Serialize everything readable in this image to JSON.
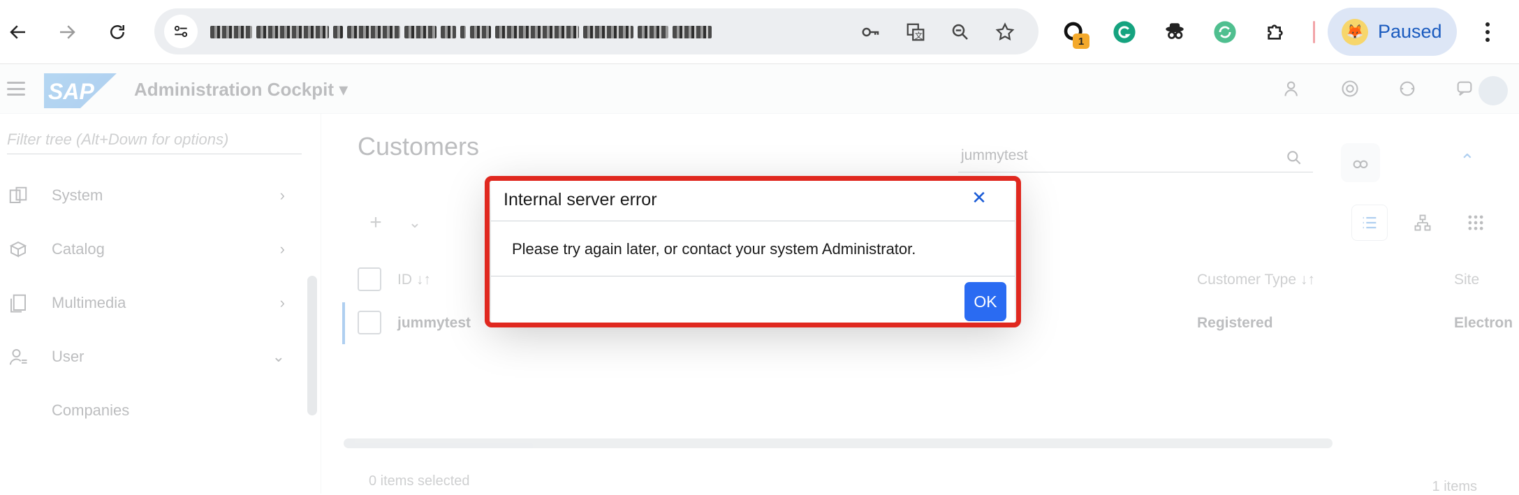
{
  "browser": {
    "url_display": "",
    "extension_badge": "1",
    "profile_label": "Paused",
    "colors": {
      "separator": "#f2a4a8",
      "profile_bg": "#dde6f6",
      "profile_text": "#1a5bbf"
    }
  },
  "app": {
    "title": "Administration Cockpit",
    "brand": "SAP",
    "sidebar": {
      "filter_placeholder": "Filter tree (Alt+Down for options)",
      "items": [
        {
          "label": "System",
          "icon": "system-icon",
          "chevron": "›"
        },
        {
          "label": "Catalog",
          "icon": "catalog-icon",
          "chevron": "›"
        },
        {
          "label": "Multimedia",
          "icon": "multimedia-icon",
          "chevron": "›"
        },
        {
          "label": "User",
          "icon": "user-icon",
          "chevron": "⌄"
        },
        {
          "label": "Companies",
          "icon": "",
          "chevron": ""
        }
      ]
    },
    "main": {
      "page_title": "Customers",
      "search_value": "jummytest",
      "table": {
        "columns": [
          "ID",
          "Customer Type",
          "Site"
        ],
        "sort_glyph": "↓↑",
        "rows": [
          {
            "id": "jummytest",
            "customer_type": "Registered",
            "site": "Electron"
          }
        ]
      },
      "footer_left": "0 items selected",
      "footer_right": "1 items"
    }
  },
  "dialog": {
    "title": "Internal server error",
    "close_glyph": "✕",
    "message": "Please try again later, or contact your system Administrator.",
    "ok_label": "OK",
    "colors": {
      "highlight_border": "#e0281f",
      "ok_button": "#2a6bf2",
      "close_icon": "#1a5bd6"
    }
  }
}
